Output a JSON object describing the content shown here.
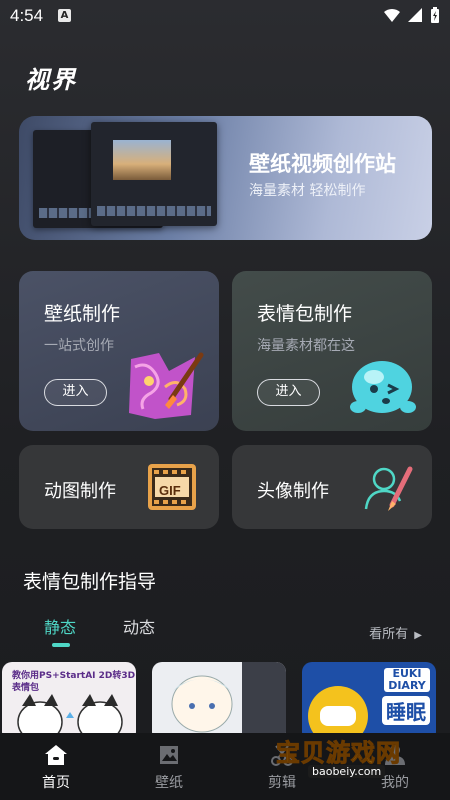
{
  "status_bar": {
    "time": "4:54",
    "notif_badge": "A"
  },
  "app": {
    "title": "视界"
  },
  "banner": {
    "title": "壁纸视频创作站",
    "subtitle": "海量素材 轻松制作"
  },
  "cards": {
    "wallpaper": {
      "title": "壁纸制作",
      "subtitle": "一站式创作",
      "button": "进入"
    },
    "emoji": {
      "title": "表情包制作",
      "subtitle": "海量素材都在这",
      "button": "进入"
    },
    "gif": {
      "title": "动图制作",
      "badge": "GIF"
    },
    "avatar": {
      "title": "头像制作"
    }
  },
  "guide": {
    "title": "表情包制作指导",
    "tabs": [
      {
        "label": "静态",
        "selected": true
      },
      {
        "label": "动态",
        "selected": false
      }
    ],
    "see_all": "看所有",
    "thumbnails": [
      {
        "text": "教你用PS+StartAI 2D转3D表情包"
      },
      {
        "text": ""
      },
      {
        "top_text": "EUKI DIARY",
        "label": "睡眠"
      }
    ]
  },
  "bottom_nav": [
    {
      "label": "首页",
      "icon": "home-icon",
      "active": true
    },
    {
      "label": "壁纸",
      "icon": "image-icon",
      "active": false
    },
    {
      "label": "剪辑",
      "icon": "scissors-icon",
      "active": false
    },
    {
      "label": "我的",
      "icon": "user-icon",
      "active": false
    }
  ],
  "watermark": {
    "text": "宝贝游戏网",
    "url": "baobeiy.com"
  },
  "colors": {
    "accent": "#4fd7c6",
    "background": "#1f2023",
    "nav_bg": "#151618"
  }
}
